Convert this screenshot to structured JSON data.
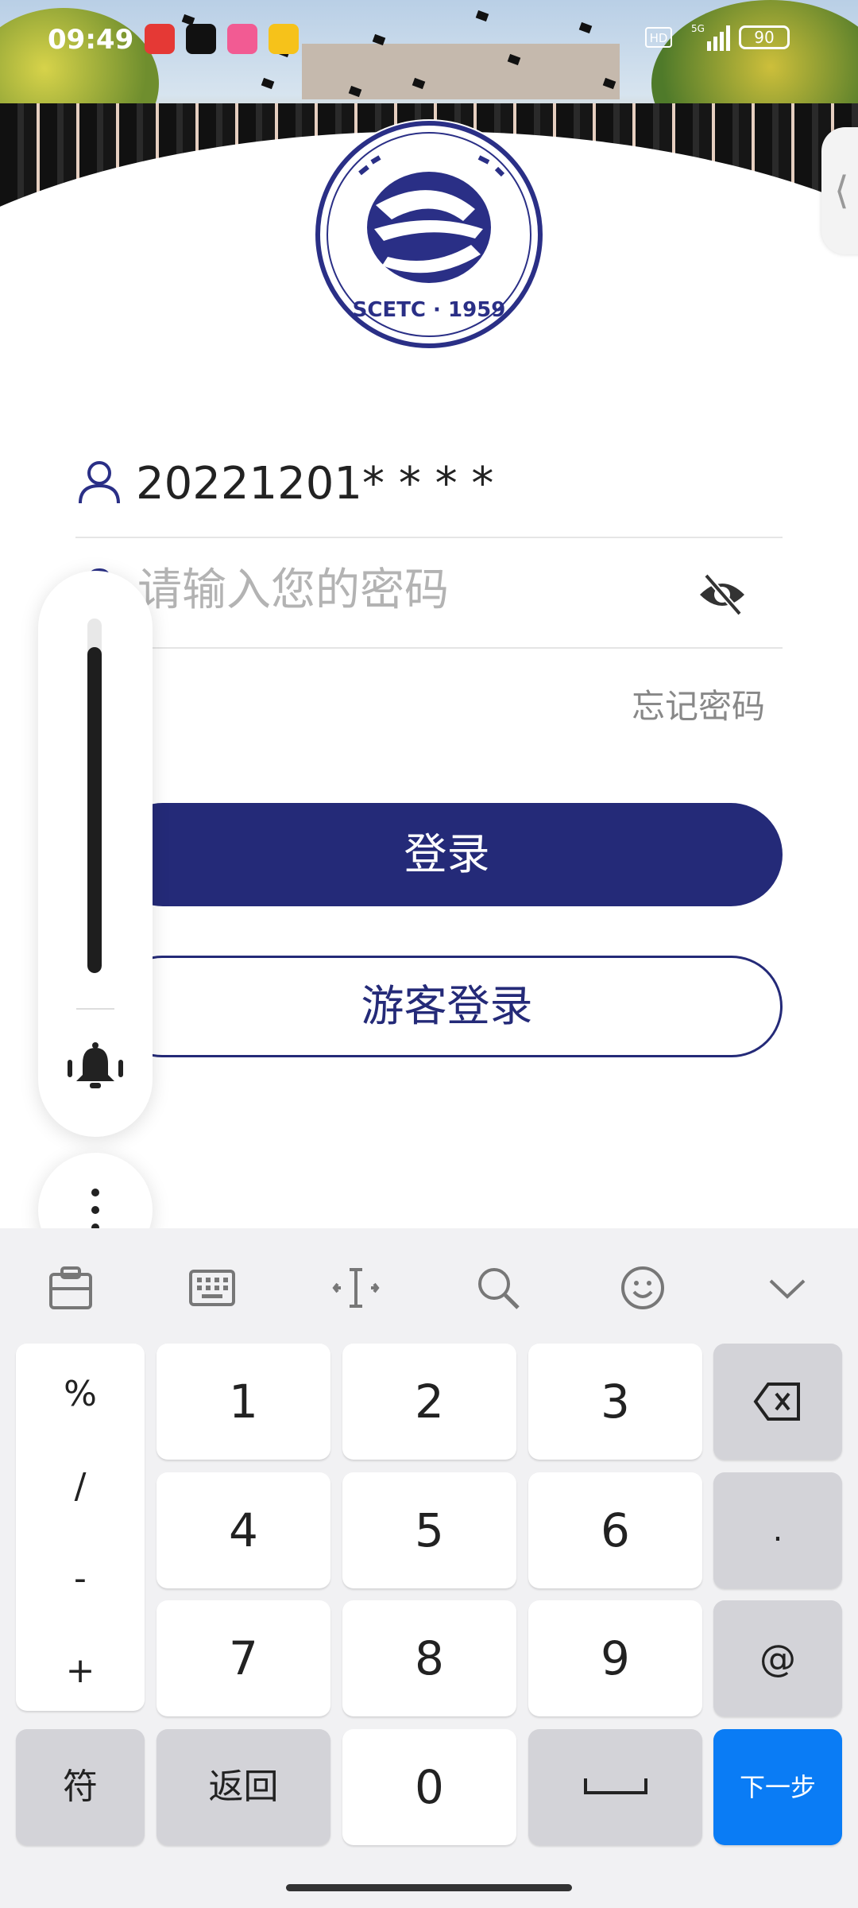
{
  "status_bar": {
    "time": "09:49",
    "hd": "HD",
    "network": "5G",
    "battery": "90"
  },
  "logo": {
    "text": "SCETC · 1959"
  },
  "login": {
    "username": "20221201* * * *",
    "password_placeholder": "请输入您的密码",
    "forgot_password": "忘记密码",
    "login_button": "登录",
    "guest_button": "游客登录"
  },
  "volume": {
    "level": 0.92
  },
  "keyboard": {
    "toolbar": [
      "clipboard-icon",
      "keyboard-icon",
      "cursor-icon",
      "search-icon",
      "emoji-icon",
      "collapse-icon"
    ],
    "symbols": [
      "%",
      "/",
      "-",
      "+"
    ],
    "keys": {
      "k1": "1",
      "k2": "2",
      "k3": "3",
      "k4": "4",
      "k5": "5",
      "k6": "6",
      "k7": "7",
      "k8": "8",
      "k9": "9",
      "k0": "0",
      "dot": ".",
      "at": "@"
    },
    "symbol_key": "符",
    "back_key": "返回",
    "next_key": "下一步"
  },
  "colors": {
    "primary": "#242a78",
    "next_key": "#0a7cf5"
  }
}
